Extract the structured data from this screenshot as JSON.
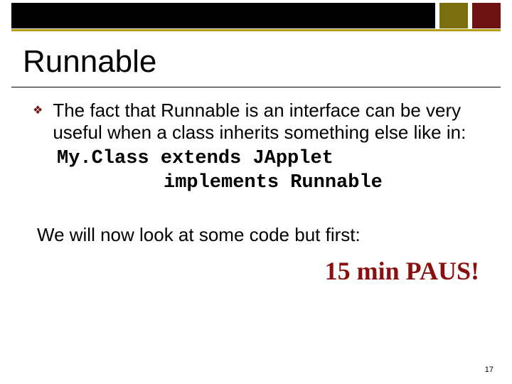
{
  "title": "Runnable",
  "bullet": "The fact that Runnable is an interface can be very useful when a class inherits something else like in:",
  "code_line1": "My.Class extends JApplet",
  "code_line2": "implements Runnable",
  "followup": "We will now look at some code but first:",
  "paus": "15 min PAUS!",
  "page_number": "17"
}
